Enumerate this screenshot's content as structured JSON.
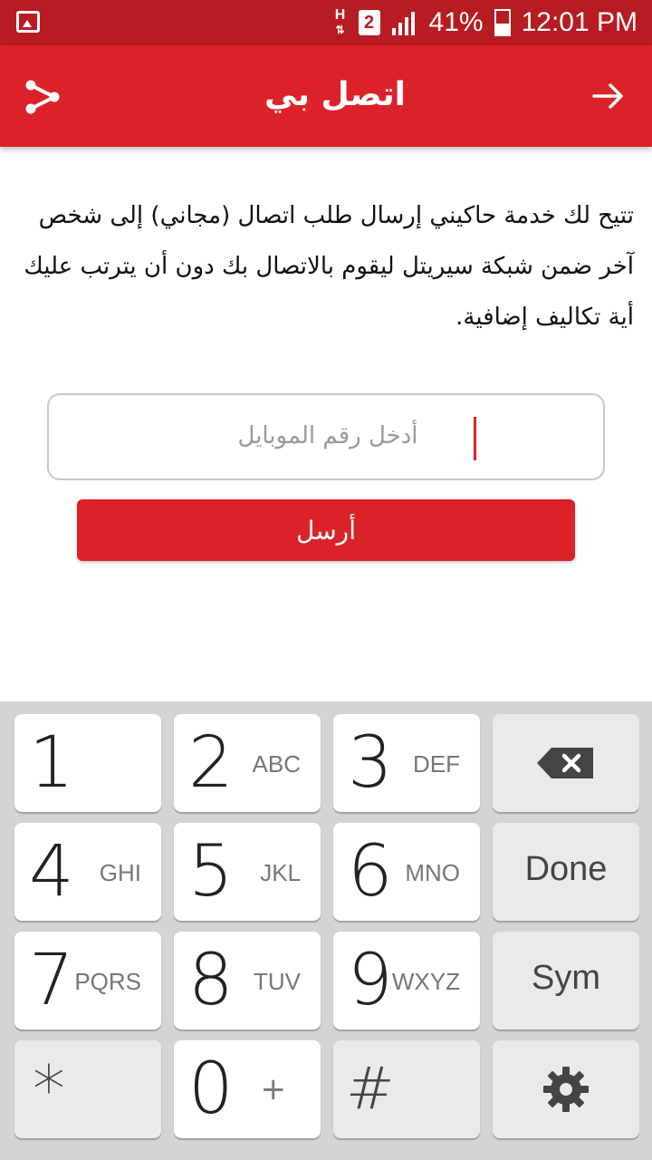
{
  "status_bar": {
    "battery": "41%",
    "time": "12:01 PM",
    "sim": "2",
    "network": "H"
  },
  "app_bar": {
    "title": "اتصل بي",
    "share_icon": "share-icon",
    "back_icon": "arrow-forward-icon"
  },
  "description": "تتيح لك خدمة حاكيني إرسال طلب اتصال (مجاني) إلى شخص آخر ضمن شبكة سيريتل ليقوم بالاتصال بك دون أن يترتب عليك أية تكاليف إضافية.",
  "phone_input": {
    "placeholder": "أدخل رقم الموبايل",
    "value": ""
  },
  "send_button": {
    "label": "أرسل"
  },
  "keyboard": {
    "keys": [
      {
        "digit": "1",
        "letters": ""
      },
      {
        "digit": "2",
        "letters": "ABC"
      },
      {
        "digit": "3",
        "letters": "DEF"
      },
      {
        "digit": "4",
        "letters": "GHI"
      },
      {
        "digit": "5",
        "letters": "JKL"
      },
      {
        "digit": "6",
        "letters": "MNO"
      },
      {
        "digit": "7",
        "letters": "PQRS"
      },
      {
        "digit": "8",
        "letters": "TUV"
      },
      {
        "digit": "9",
        "letters": "WXYZ"
      },
      {
        "digit": "*",
        "letters": ""
      },
      {
        "digit": "0",
        "letters": "+"
      },
      {
        "digit": "#",
        "letters": ""
      }
    ],
    "done_label": "Done",
    "sym_label": "Sym",
    "backspace_icon": "backspace-icon",
    "settings_icon": "gear-icon"
  },
  "colors": {
    "accent": "#dc2229",
    "status_bar": "#b71c22",
    "keyboard_bg": "#d2d4d6"
  }
}
